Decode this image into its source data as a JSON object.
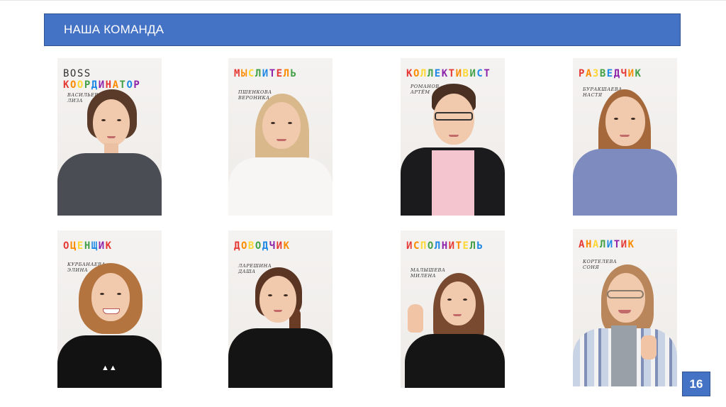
{
  "header": {
    "title": "НАША КОМАНДА"
  },
  "team": [
    {
      "role": "КООРДИНАТОР",
      "prefix": "BOSS",
      "name": "ВАСИЛЬЕВА\nЛИЗА",
      "colors": [
        "#e53935",
        "#fb8c00",
        "#fdd835",
        "#43a047",
        "#1e88e5",
        "#8e24aa",
        "#e53935",
        "#fb8c00",
        "#43a047",
        "#1e88e5",
        "#8e24aa"
      ]
    },
    {
      "role": "МЫСЛИТЕЛЬ",
      "prefix": "",
      "name": "ПШЕНКОВА\nВЕРОНИКА",
      "colors": [
        "#e53935",
        "#fb8c00",
        "#fdd835",
        "#43a047",
        "#1e88e5",
        "#8e24aa",
        "#e53935",
        "#fb8c00",
        "#43a047"
      ]
    },
    {
      "role": "КОЛЛЕКТИВИСТ",
      "prefix": "",
      "name": "РОМАНОВ\nАРТЁМ",
      "colors": [
        "#e53935",
        "#fb8c00",
        "#fdd835",
        "#43a047",
        "#1e88e5",
        "#8e24aa",
        "#e53935",
        "#fb8c00",
        "#fdd835",
        "#43a047",
        "#1e88e5",
        "#8e24aa"
      ]
    },
    {
      "role": "РАЗВЕДЧИК",
      "prefix": "",
      "name": "БУРАКШАЕВА\nНАСТЯ",
      "colors": [
        "#e53935",
        "#fb8c00",
        "#fdd835",
        "#43a047",
        "#1e88e5",
        "#8e24aa",
        "#e53935",
        "#fb8c00",
        "#43a047"
      ]
    },
    {
      "role": "ОЦЕНЩИК",
      "prefix": "",
      "name": "КУРБАНАЕВА\nЭЛИНА",
      "colors": [
        "#e53935",
        "#fb8c00",
        "#fdd835",
        "#43a047",
        "#1e88e5",
        "#8e24aa",
        "#e53935"
      ]
    },
    {
      "role": "ДОВОДЧИК",
      "prefix": "",
      "name": "ЛАРЕШИНА\nДАША",
      "colors": [
        "#e53935",
        "#fb8c00",
        "#fdd835",
        "#43a047",
        "#1e88e5",
        "#8e24aa",
        "#e53935",
        "#fb8c00"
      ]
    },
    {
      "role": "ИСПОЛНИТЕЛЬ",
      "prefix": "",
      "name": "МАЛЫШЕВА\nМИЛЕНА",
      "colors": [
        "#e53935",
        "#fb8c00",
        "#fdd835",
        "#43a047",
        "#1e88e5",
        "#8e24aa",
        "#e53935",
        "#fb8c00",
        "#fdd835",
        "#43a047",
        "#1e88e5"
      ]
    },
    {
      "role": "АНАЛИТИК",
      "prefix": "",
      "name": "КОРТЕЛЕВА\nСОНЯ",
      "colors": [
        "#e53935",
        "#fb8c00",
        "#fdd835",
        "#43a047",
        "#1e88e5",
        "#8e24aa",
        "#e53935",
        "#fb8c00"
      ]
    }
  ],
  "page_number": "16"
}
